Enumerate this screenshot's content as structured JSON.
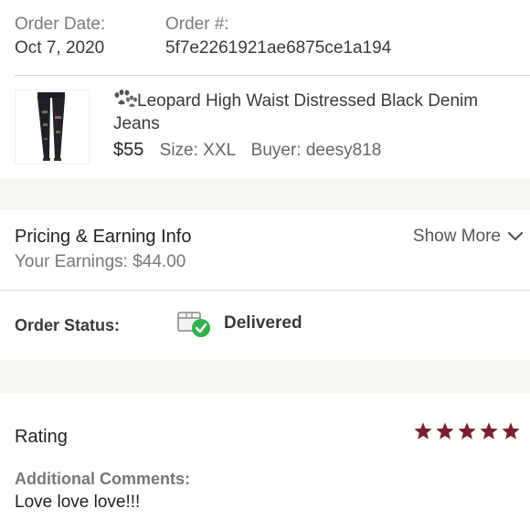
{
  "order": {
    "date_label": "Order Date:",
    "date_value": "Oct 7, 2020",
    "number_label": "Order #:",
    "number_value": "5f7e2261921ae6875ce1a194"
  },
  "product": {
    "title": "Leopard High Waist Distressed Black Denim Jeans",
    "price": "$55",
    "size": "Size: XXL",
    "buyer": "Buyer: deesy818",
    "title_icon": "paw-print-icon",
    "thumbnail_icon": "jeans-thumbnail"
  },
  "pricing": {
    "title": "Pricing & Earning Info",
    "earnings": "Your Earnings: $44.00",
    "show_more": "Show More"
  },
  "status": {
    "label": "Order Status:",
    "value": "Delivered",
    "icon": "delivered-box-check-icon",
    "check_color": "#2fb24a"
  },
  "rating": {
    "title": "Rating",
    "stars": 5,
    "star_color": "#7a1f2e",
    "comments_label": "Additional Comments:",
    "comments": "Love love love!!!"
  },
  "colors": {
    "band": "#f7f5f1",
    "divider": "#d9d9d9"
  }
}
